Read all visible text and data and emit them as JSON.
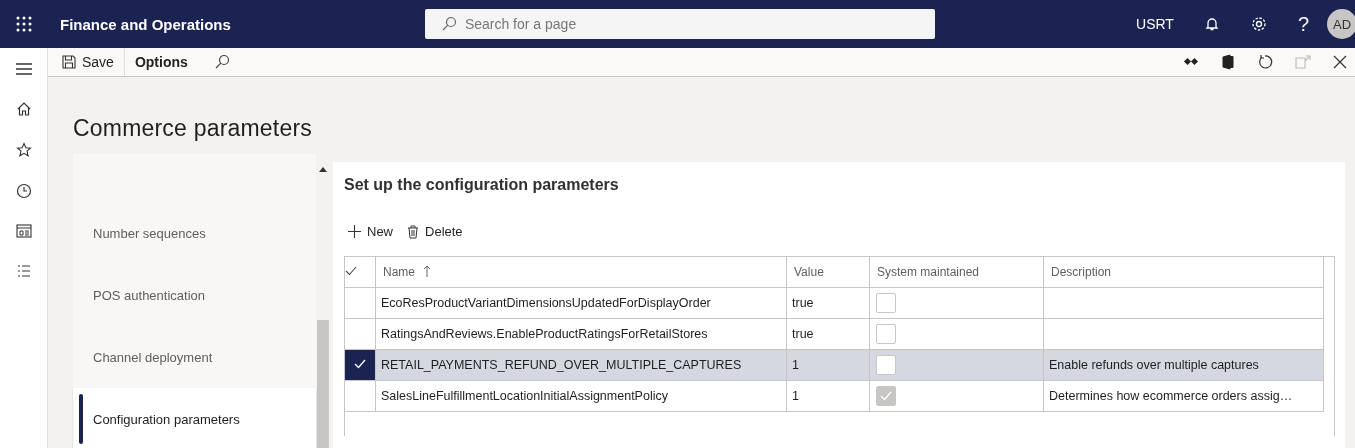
{
  "app_bar": {
    "title": "Finance and Operations",
    "search": {
      "placeholder": "Search for a page"
    },
    "company": "USRT",
    "help": "?",
    "avatar": "AD"
  },
  "toolbar": {
    "buttons": [
      "Save",
      "Options"
    ]
  },
  "page_title": "Commerce parameters",
  "nav": {
    "items": [
      {
        "label": "Number sequences",
        "selected": false
      },
      {
        "label": "POS authentication",
        "selected": false
      },
      {
        "label": "Channel deployment",
        "selected": false
      },
      {
        "label": "Configuration parameters",
        "selected": true
      }
    ]
  },
  "section": {
    "title": "Set up the configuration parameters",
    "actions": [
      "New",
      "Delete"
    ],
    "table": {
      "columns": [
        "Name",
        "Value",
        "System maintained",
        "Description"
      ],
      "rows": [
        {
          "name": "EcoResProductVariantDimensionsUpdatedForDisplayOrder",
          "value": "true",
          "system_maintained": false,
          "disabled": false,
          "description": "",
          "selected": false
        },
        {
          "name": "RatingsAndReviews.EnableProductRatingsForRetailStores",
          "value": "true",
          "system_maintained": false,
          "disabled": false,
          "description": "",
          "selected": false
        },
        {
          "name": "RETAIL_PAYMENTS_REFUND_OVER_MULTIPLE_CAPTURES",
          "value": "1",
          "system_maintained": false,
          "disabled": false,
          "description": "Enable refunds over multiple captures",
          "selected": true
        },
        {
          "name": "SalesLineFulfillmentLocationInitialAssignmentPolicy",
          "value": "1",
          "system_maintained": true,
          "disabled": true,
          "description": "Determines how ecommerce orders assig…",
          "selected": false
        }
      ]
    }
  }
}
